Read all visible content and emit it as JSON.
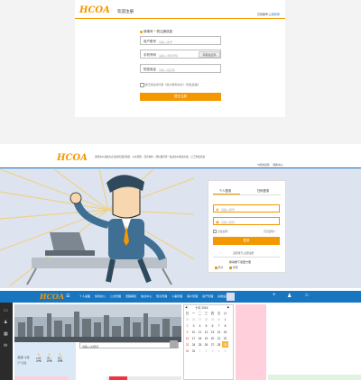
{
  "s1": {
    "logo": "HCOA",
    "header_title": "欢迎注册",
    "header_right_prefix": "已有账号,",
    "header_right_link": "立即登录",
    "hint_prefix": "请填写",
    "hint_highlight": "***",
    "hint_suffix": "的注册信息",
    "fields": [
      {
        "label": "用户账号",
        "placeholder": "请输入账号"
      },
      {
        "label": "手机号码",
        "placeholder": "请输入手机号码",
        "button": "获取验证码"
      },
      {
        "label": "短信验证",
        "placeholder": "请输入验证码"
      }
    ],
    "agree_text": "我已阅读并同意《用户服务协议》《隐私政策》",
    "submit": "提交注册"
  },
  "s2": {
    "logo": "HCOA",
    "banner_text": "协同办公系统为企业提供流程审批、公文管理、任务协作、即时通讯等一站式办公解决方案，让工作更高效",
    "edit_link": "修改密码",
    "help_link": "帮助中心",
    "tabs": [
      "个人登录",
      "扫码登录"
    ],
    "username_placeholder": "请输入账号",
    "password_placeholder": "请输入密码",
    "remember": "记住密码",
    "forgot": "忘记密码?",
    "login_button": "登录",
    "register_link": "没有账号,立即注册",
    "download_title": "移动端下载更方便",
    "download_items": [
      "安卓",
      "苹果"
    ]
  },
  "s3": {
    "logo": "HCOA",
    "nav_items": [
      "个人桌面",
      "协同办公",
      "公文管理",
      "流程审批",
      "信息中心",
      "知识管理",
      "人事管理",
      "客户管理",
      "资产管理",
      "系统设置"
    ],
    "search_placeholder": "请输入关键词",
    "calendar_title": "十月 2016",
    "weekdays": [
      "日",
      "一",
      "二",
      "三",
      "四",
      "五",
      "六"
    ],
    "days": [
      [
        "25",
        "26",
        "27",
        "28",
        "29",
        "30",
        "1"
      ],
      [
        "2",
        "3",
        "4",
        "5",
        "6",
        "7",
        "8"
      ],
      [
        "9",
        "10",
        "11",
        "12",
        "13",
        "14",
        "15"
      ],
      [
        "16",
        "17",
        "18",
        "19",
        "20",
        "21",
        "22"
      ],
      [
        "23",
        "24",
        "25",
        "26",
        "27",
        "28",
        "29"
      ],
      [
        "30",
        "31",
        "1",
        "2",
        "3",
        "4",
        "5"
      ]
    ],
    "weather_city": "北京",
    "weather_label": "今天",
    "weather_items": [
      {
        "day": "10月",
        "temp": "25℃"
      },
      {
        "day": "周二",
        "temp": "20℃"
      },
      {
        "day": "周三",
        "temp": "18℃"
      }
    ],
    "weather_sub": "空气质量"
  },
  "colors": {
    "accent": "#f39800",
    "blue": "#1875c0",
    "pink": "#ffd0dc",
    "dark": "#2b2b2b"
  }
}
